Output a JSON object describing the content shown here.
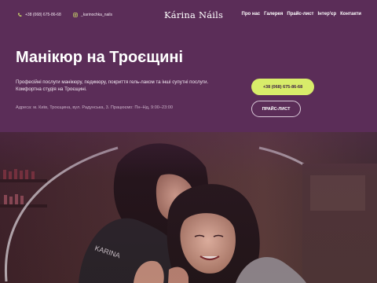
{
  "header": {
    "phone": "+38 (068) 675-86-68",
    "instagram": "_karinochka_nails",
    "brand": "Kárina Náils",
    "nav": [
      "Про нас",
      "Галерея",
      "Прайс-лист",
      "Інтер'єр",
      "Контакти"
    ]
  },
  "hero": {
    "title": "Манікюр на Троєщині",
    "description": "Професійні послуги манікюру, педикюру, покриття гель-лаком та інші супутні послуги. Комфортна студія на Троєщині.",
    "address": "Адреса: м. Київ, Троєщина, вул. Радунська, 3. Працюємо: Пн–Нд, 9:00–23:00",
    "phone_button": "+38 (068) 675-86-68",
    "price_button": "ПРАЙС-ЛИСТ"
  },
  "colors": {
    "background": "#5b2d58",
    "accent": "#d8ec6a",
    "text": "#ffffff"
  },
  "icons": {
    "phone": "phone-icon",
    "instagram": "instagram-icon"
  }
}
